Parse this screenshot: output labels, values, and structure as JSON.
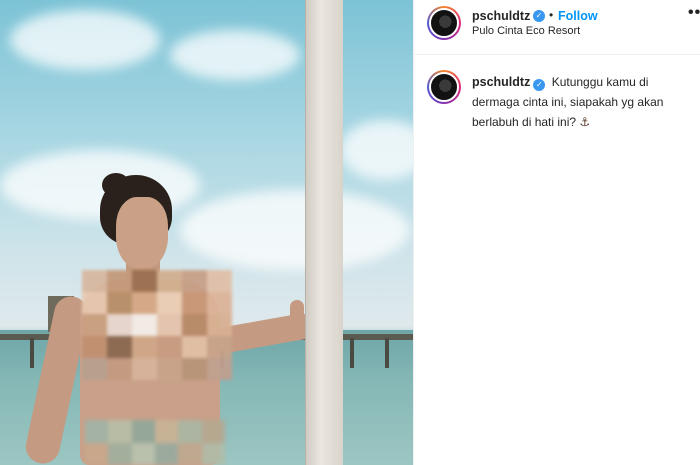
{
  "post": {
    "username": "pschuldtz",
    "verified_mark": "✓",
    "follow_separator": "•",
    "follow_label": "Follow",
    "location": "Pulo Cinta Eco Resort",
    "more_icon": "•••",
    "caption": {
      "username": "pschuldtz",
      "text": "Kutunggu kamu di dermaga cinta ini, siapakah yg akan berlabuh di hati ini?",
      "emoji": "⚓"
    }
  },
  "icons": {
    "verified": "verified-badge-icon",
    "more": "more-options-icon",
    "avatar": "profile-avatar"
  },
  "colors": {
    "follow": "#0095f6",
    "verified": "#3897f0",
    "text": "#262626",
    "border": "#efefef"
  }
}
